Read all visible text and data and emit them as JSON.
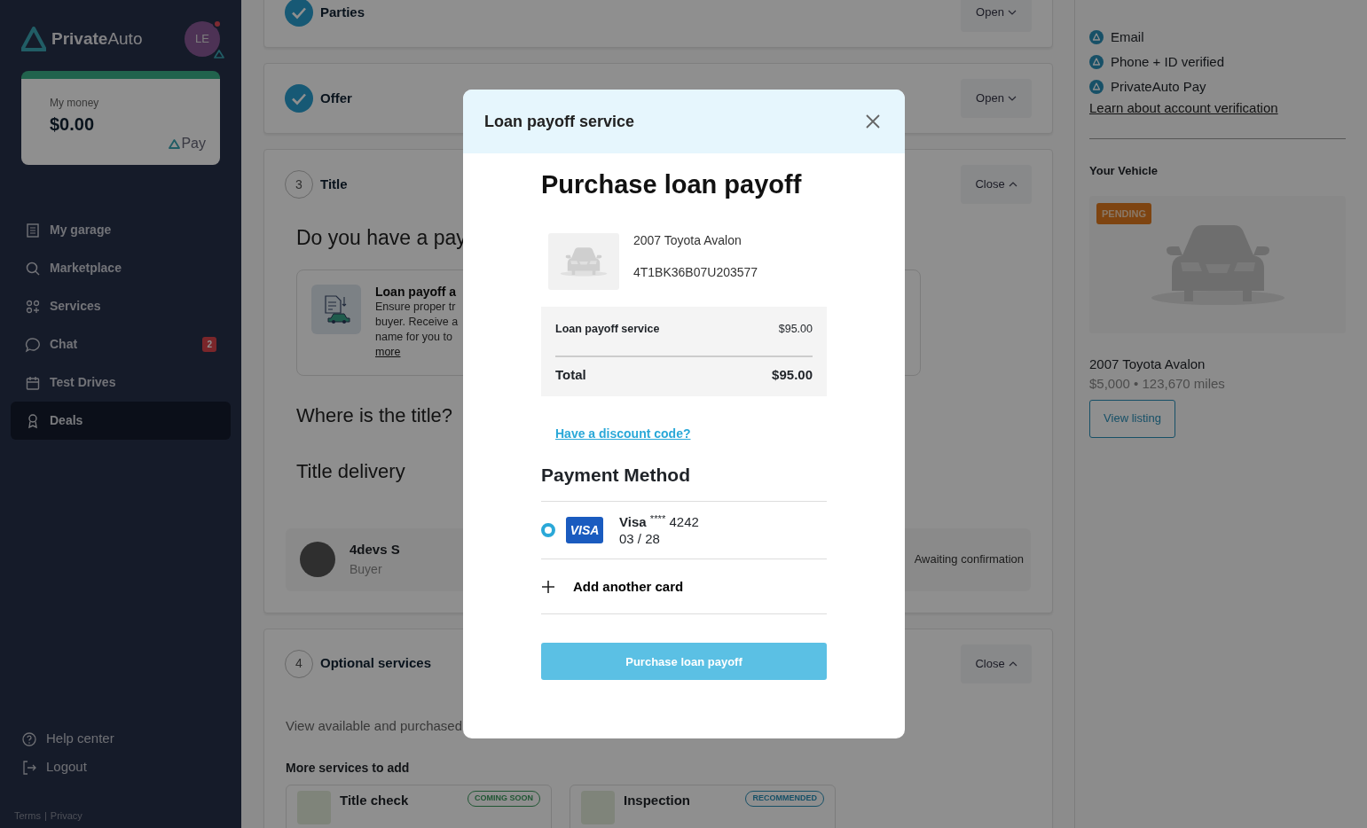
{
  "sidebar": {
    "brand": {
      "bold": "Private",
      "light": "Auto"
    },
    "avatar": {
      "initials": "LE",
      "notification": true
    },
    "money": {
      "label": "My money",
      "amount": "$0.00",
      "pay_logo": "Pay"
    },
    "nav": [
      {
        "label": "My garage",
        "selected": false
      },
      {
        "label": "Marketplace",
        "selected": false
      },
      {
        "label": "Services",
        "selected": false
      },
      {
        "label": "Chat",
        "selected": false,
        "badge": "2"
      },
      {
        "label": "Test Drives",
        "selected": false
      },
      {
        "label": "Deals",
        "selected": true
      }
    ],
    "footer_links": [
      {
        "label": "Help center"
      },
      {
        "label": "Logout"
      }
    ],
    "legal": {
      "terms": "Terms",
      "separator": "|",
      "privacy": "Privacy"
    }
  },
  "steps": [
    {
      "kind": "done",
      "title": "Parties",
      "toggle": "Open",
      "expanded": false
    },
    {
      "kind": "done",
      "title": "Offer",
      "toggle": "Open",
      "expanded": false
    },
    {
      "kind": "number",
      "number": "3",
      "title": "Title",
      "toggle": "Close",
      "expanded": true,
      "question": "Do you have a pay",
      "service": {
        "title": "Loan payoff a",
        "lines": [
          "Ensure proper tr",
          "buyer. Receive a",
          "name for you to"
        ],
        "link": "more"
      },
      "headings": [
        "Where is the title?",
        "Title delivery"
      ],
      "participant": {
        "name": "4devs S",
        "role": "Buyer",
        "status": "Awaiting confirmation"
      }
    },
    {
      "kind": "number",
      "number": "4",
      "title": "Optional services",
      "toggle": "Close",
      "expanded": true,
      "description": "View available and purchased",
      "more_heading": "More services to add",
      "services": [
        {
          "title": "Title check",
          "badge": "COMING SOON",
          "kind": "soon"
        },
        {
          "title": "Inspection",
          "badge": "RECOMMENDED",
          "kind": "recommended"
        }
      ]
    }
  ],
  "profile": {
    "verifications": [
      "Email",
      "Phone + ID verified",
      "PrivateAuto Pay"
    ],
    "link": "Learn about account verification",
    "vehicle": {
      "heading": "Your Vehicle",
      "status": "PENDING",
      "name": "2007 Toyota Avalon",
      "details": "$5,000 • 123,670 miles",
      "button": "View listing"
    }
  },
  "modal": {
    "title": "Loan payoff service",
    "heading": "Purchase loan payoff",
    "vehicle": {
      "name": "2007 Toyota Avalon",
      "vin": "4T1BK36B07U203577"
    },
    "lines": [
      {
        "kind": "item",
        "label": "Loan payoff service",
        "amount": "$95.00"
      },
      {
        "kind": "total",
        "label": "Total",
        "amount": "$95.00"
      }
    ],
    "discount_link": "Have a discount code?",
    "payment_heading": "Payment Method",
    "cards": [
      {
        "logo": "VISA",
        "label": "**Visa** $^{****}$ 4242",
        "expiry": "03 / 28",
        "selected": true
      }
    ],
    "add_card": "Add another card",
    "submit": "Purchase loan payoff"
  }
}
